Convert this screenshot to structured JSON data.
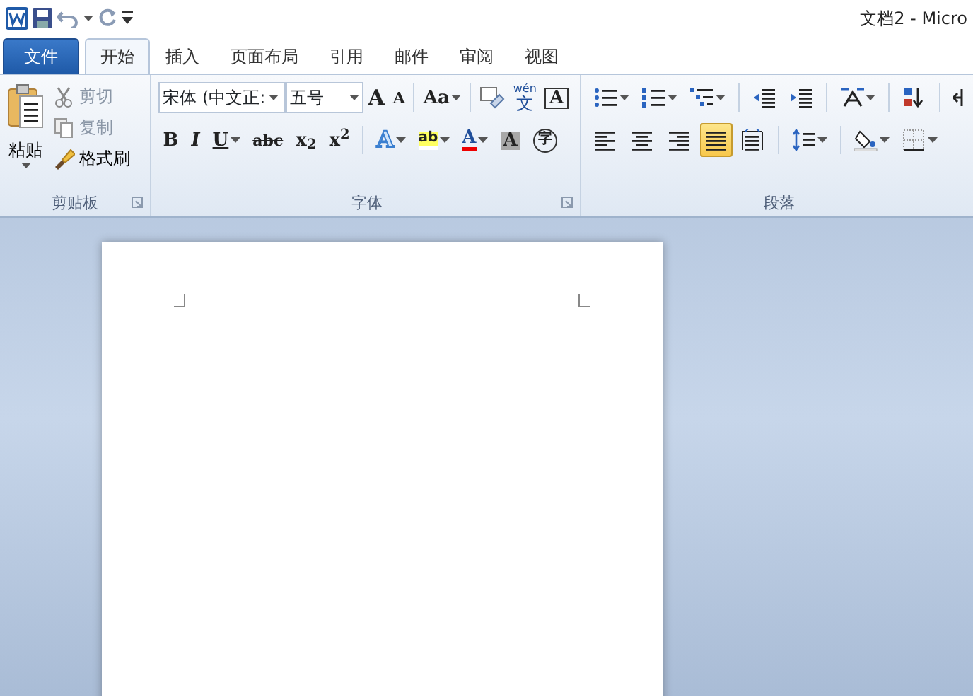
{
  "title_bar": {
    "title": "文档2  -  Micro"
  },
  "tabs": [
    {
      "label": "文件",
      "kind": "file",
      "selected": false
    },
    {
      "label": "开始",
      "kind": "tab",
      "selected": true
    },
    {
      "label": "插入",
      "kind": "tab",
      "selected": false
    },
    {
      "label": "页面布局",
      "kind": "tab",
      "selected": false
    },
    {
      "label": "引用",
      "kind": "tab",
      "selected": false
    },
    {
      "label": "邮件",
      "kind": "tab",
      "selected": false
    },
    {
      "label": "审阅",
      "kind": "tab",
      "selected": false
    },
    {
      "label": "视图",
      "kind": "tab",
      "selected": false
    }
  ],
  "clipboard": {
    "label": "剪贴板",
    "paste": "粘贴",
    "items": [
      {
        "label": "剪切",
        "kind": "cut",
        "disabled": true
      },
      {
        "label": "复制",
        "kind": "copy",
        "disabled": true
      },
      {
        "label": "格式刷",
        "kind": "brush",
        "disabled": false
      }
    ]
  },
  "font": {
    "label": "字体",
    "font_name": "宋体 (中文正:",
    "font_size": "五号",
    "row1": [
      {
        "kind": "grow",
        "text": "A"
      },
      {
        "kind": "shrink",
        "text": "A"
      },
      {
        "kind": "sep"
      },
      {
        "kind": "case",
        "text": "Aa",
        "dropdown": true
      },
      {
        "kind": "sep"
      },
      {
        "kind": "clear"
      },
      {
        "kind": "ruby",
        "ruby": "wén",
        "text": "文"
      },
      {
        "kind": "boxed",
        "text": "A"
      }
    ],
    "row2": [
      {
        "kind": "bold",
        "text": "B"
      },
      {
        "kind": "italic",
        "text": "I"
      },
      {
        "kind": "underline",
        "text": "U",
        "dropdown": true
      },
      {
        "kind": "strike",
        "text": "abc"
      },
      {
        "kind": "plain",
        "text": "x$_{2}$"
      },
      {
        "kind": "plain",
        "text": "x$^{2}$"
      },
      {
        "kind": "sep"
      },
      {
        "kind": "effect",
        "text": "A",
        "dropdown": true
      },
      {
        "kind": "highlight",
        "text": "ab",
        "dropdown": true
      },
      {
        "kind": "color",
        "text": "A",
        "dropdown": true
      },
      {
        "kind": "shade",
        "text": "A"
      },
      {
        "kind": "circled",
        "text": "字"
      }
    ]
  },
  "paragraph": {
    "label": "段落",
    "row1": [
      {
        "kind": "bullets",
        "dropdown": true
      },
      {
        "kind": "numbering",
        "dropdown": true
      },
      {
        "kind": "multilevel",
        "dropdown": true
      },
      {
        "kind": "sep"
      },
      {
        "kind": "outdent"
      },
      {
        "kind": "indent"
      },
      {
        "kind": "sep"
      },
      {
        "kind": "asian",
        "dropdown": true
      },
      {
        "kind": "sep"
      },
      {
        "kind": "sort"
      },
      {
        "kind": "sep"
      },
      {
        "kind": "marks"
      }
    ],
    "align": [
      {
        "kind": "left",
        "selected": false
      },
      {
        "kind": "center",
        "selected": false
      },
      {
        "kind": "right",
        "selected": false
      },
      {
        "kind": "justify",
        "selected": true
      },
      {
        "kind": "distributed",
        "selected": false
      }
    ],
    "row2": [
      {
        "kind": "sep"
      },
      {
        "kind": "spacing",
        "dropdown": true
      },
      {
        "kind": "sep"
      },
      {
        "kind": "fill",
        "dropdown": true
      },
      {
        "kind": "borders",
        "dropdown": true
      }
    ]
  }
}
